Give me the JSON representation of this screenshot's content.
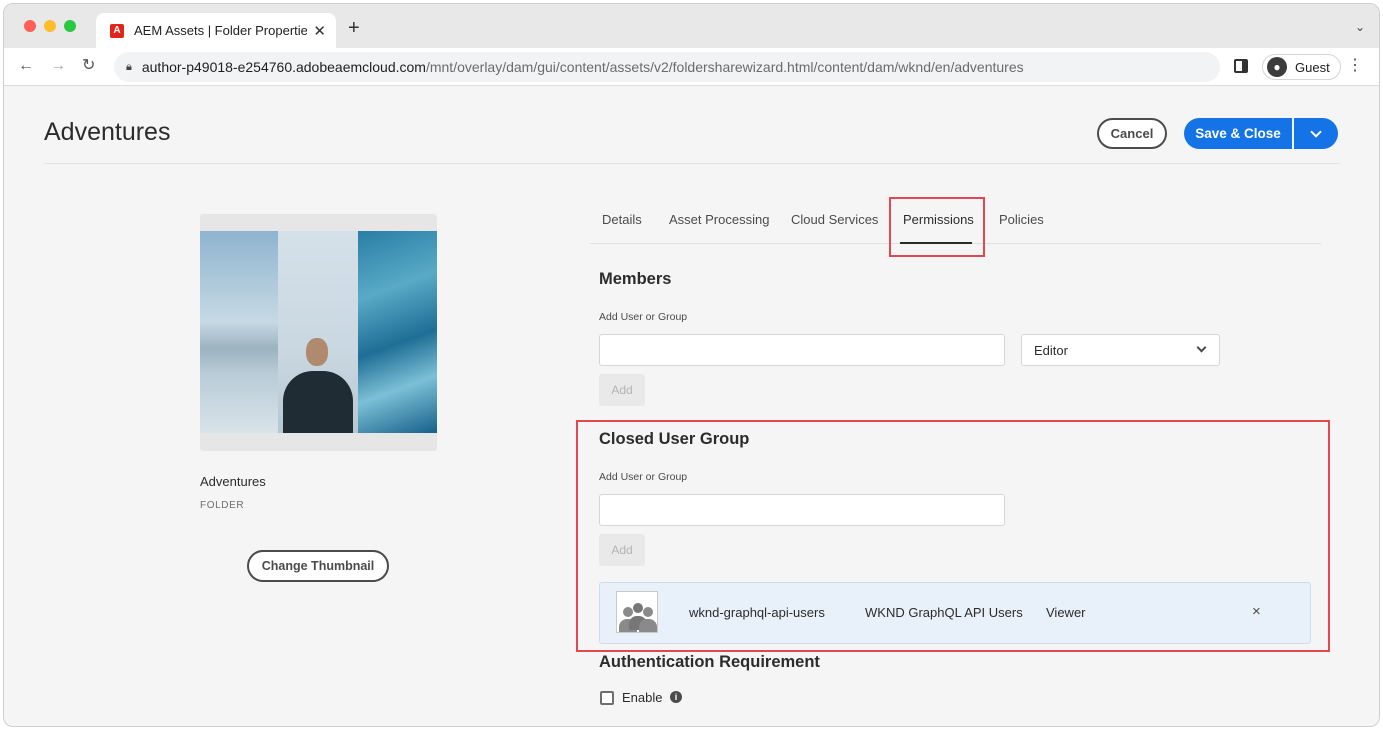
{
  "browser": {
    "tab_title": "AEM Assets | Folder Properties",
    "favicon_glyph": "A",
    "url_host": "author-p49018-e254760.adobeaemcloud.com",
    "url_path": "/mnt/overlay/dam/gui/content/assets/v2/foldersharewizard.html/content/dam/wknd/en/adventures",
    "profile_label": "Guest"
  },
  "header": {
    "title": "Adventures",
    "cancel_label": "Cancel",
    "save_label": "Save & Close"
  },
  "asset": {
    "name": "Adventures",
    "type": "FOLDER",
    "change_thumbnail_label": "Change Thumbnail"
  },
  "tabs": [
    {
      "label": "Details"
    },
    {
      "label": "Asset Processing"
    },
    {
      "label": "Cloud Services"
    },
    {
      "label": "Permissions",
      "active": true
    },
    {
      "label": "Policies"
    }
  ],
  "members": {
    "title": "Members",
    "field_label": "Add User or Group",
    "input_value": "",
    "role_selected": "Editor",
    "add_label": "Add"
  },
  "closed_user_group": {
    "title": "Closed User Group",
    "field_label": "Add User or Group",
    "input_value": "",
    "add_label": "Add",
    "entries": [
      {
        "id": "wknd-graphql-api-users",
        "name": "WKND GraphQL API Users",
        "role": "Viewer",
        "remove_glyph": "×"
      }
    ]
  },
  "authentication": {
    "title": "Authentication Requirement",
    "enable_label": "Enable",
    "enabled": false
  },
  "colors": {
    "accent_blue": "#1473e6",
    "highlight_red": "#e34850"
  },
  "icons": [
    "lock-icon",
    "close-icon",
    "plus-icon",
    "back-arrow-icon",
    "forward-arrow-icon",
    "reload-icon",
    "side-panel-icon",
    "user-avatar-icon",
    "more-vert-icon",
    "chevron-down-icon",
    "group-icon",
    "info-icon"
  ]
}
